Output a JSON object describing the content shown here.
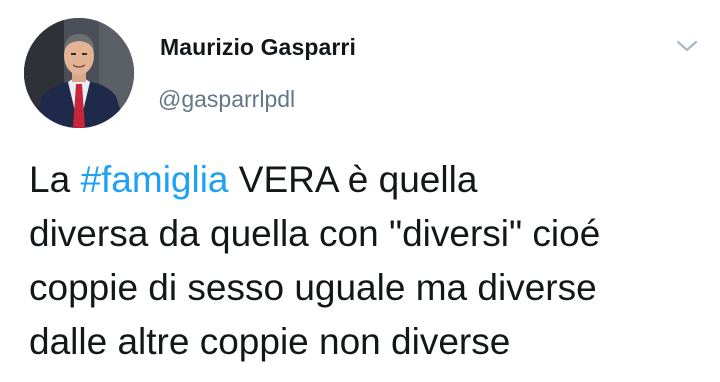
{
  "user": {
    "display_name": "Maurizio Gasparri",
    "handle": "@gasparrlpdl",
    "avatar_icon": "profile-photo"
  },
  "menu_icon": "chevron-down-icon",
  "tweet": {
    "line1": {
      "before": "La ",
      "hashtag": "#famiglia",
      "after": " VERA è quella"
    },
    "line2": "diversa da quella con \"diversi\" cioé",
    "line3": "coppie di sesso uguale ma diverse",
    "line4": "dalle altre coppie non diverse"
  },
  "colors": {
    "hashtag": "#1da1f2",
    "handle": "#657786",
    "text": "#14171a"
  }
}
